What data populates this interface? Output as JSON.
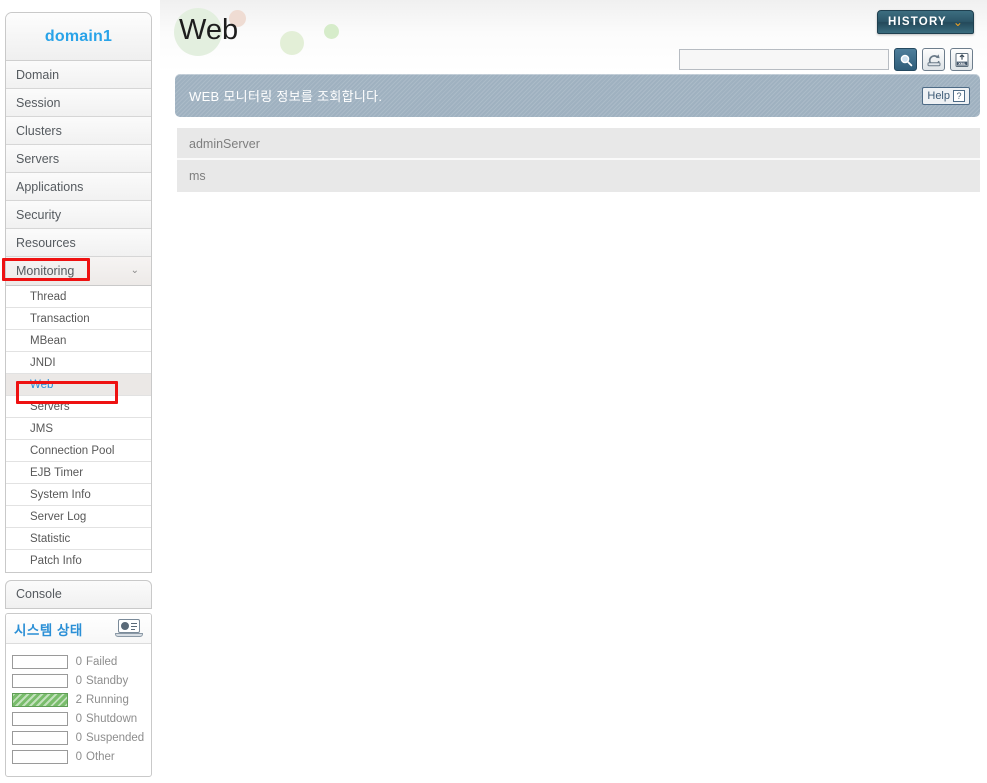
{
  "sidebar": {
    "domain_title": "domain1",
    "nav_items": [
      {
        "label": "Domain",
        "expandable": false
      },
      {
        "label": "Session",
        "expandable": false
      },
      {
        "label": "Clusters",
        "expandable": false
      },
      {
        "label": "Servers",
        "expandable": false
      },
      {
        "label": "Applications",
        "expandable": false
      },
      {
        "label": "Security",
        "expandable": false
      },
      {
        "label": "Resources",
        "expandable": false
      },
      {
        "label": "Monitoring",
        "expandable": true,
        "chevron": "⌄",
        "highlighted": true
      }
    ],
    "submenu_items": [
      {
        "label": "Thread"
      },
      {
        "label": "Transaction"
      },
      {
        "label": "MBean"
      },
      {
        "label": "JNDI"
      },
      {
        "label": "Web",
        "selected": true
      },
      {
        "label": "Servers"
      },
      {
        "label": "JMS"
      },
      {
        "label": "Connection Pool"
      },
      {
        "label": "EJB Timer"
      },
      {
        "label": "System Info"
      },
      {
        "label": "Server Log"
      },
      {
        "label": "Statistic"
      },
      {
        "label": "Patch Info"
      }
    ],
    "console_label": "Console",
    "status": {
      "title": "시스템 상태",
      "icon": "monitor-chart-icon",
      "rows": [
        {
          "count": "0",
          "name": "Failed",
          "filled": false
        },
        {
          "count": "0",
          "name": "Standby",
          "filled": false
        },
        {
          "count": "2",
          "name": "Running",
          "filled": true
        },
        {
          "count": "0",
          "name": "Shutdown",
          "filled": false
        },
        {
          "count": "0",
          "name": "Suspended",
          "filled": false
        },
        {
          "count": "0",
          "name": "Other",
          "filled": false
        }
      ],
      "running_color": "#79bd6b"
    }
  },
  "header": {
    "page_title": "Web",
    "history_button": {
      "label": "HISTORY",
      "caret": "⌄",
      "accent": "#f0a422"
    },
    "search": {
      "value": "",
      "placeholder": "",
      "buttons": [
        {
          "icon": "search-icon",
          "title": "Search"
        },
        {
          "icon": "refresh-icon",
          "title": "Refresh"
        },
        {
          "icon": "xml-export-icon",
          "title": "Export XML"
        }
      ]
    }
  },
  "message_bar": {
    "text": "WEB 모니터링 정보를 조회합니다.",
    "help_label": "Help",
    "help_mark": "?",
    "background": "#9fb1c0"
  },
  "main": {
    "server_rows": [
      {
        "label": "adminServer"
      },
      {
        "label": "ms"
      }
    ]
  }
}
